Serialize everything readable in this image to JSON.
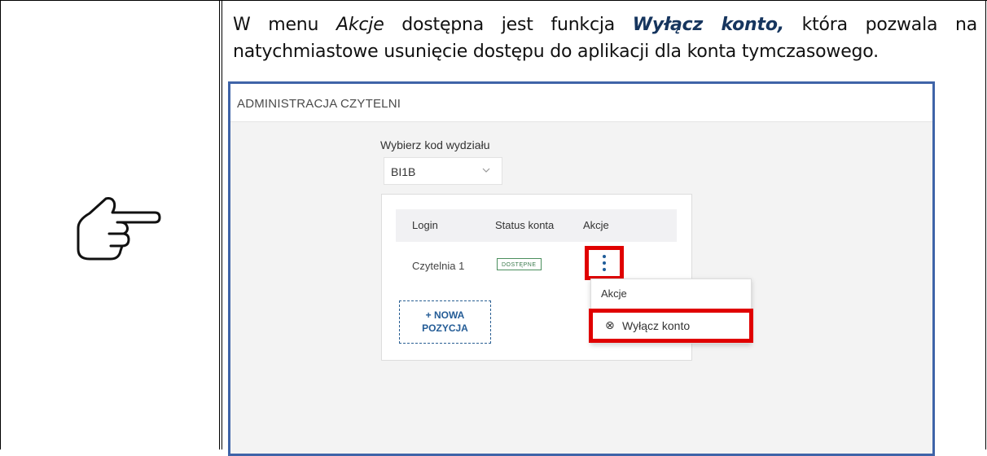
{
  "intro": {
    "p1": "W menu ",
    "menu_name": "Akcje",
    "p2": " dostępna jest funkcja ",
    "function_name": "Wyłącz konto,",
    "p3": " która pozwala na natychmiastowe usunięcie dostępu do aplikacji dla konta tymczasowego."
  },
  "screenshot": {
    "title": "ADMINISTRACJA CZYTELNI",
    "faculty_label": "Wybierz kod wydziału",
    "faculty_value": "BI1B",
    "table": {
      "columns": [
        "Login",
        "Status konta",
        "Akcje"
      ],
      "rows": [
        {
          "login": "Czytelnia 1",
          "status": "DOSTĘPNE"
        }
      ]
    },
    "new_item": [
      "+ NOWA",
      "POZYCJA"
    ],
    "menu": {
      "header": "Akcje",
      "item_icon": "⊗",
      "item": "Wyłącz konto"
    }
  },
  "colors": {
    "highlight": "#e00000",
    "screenshot_border": "#3f64a8",
    "link_blue": "#245c96"
  },
  "icons": [
    "pointing-hand-icon",
    "chevron-down-icon",
    "kebab-menu-icon",
    "circle-x-icon"
  ]
}
